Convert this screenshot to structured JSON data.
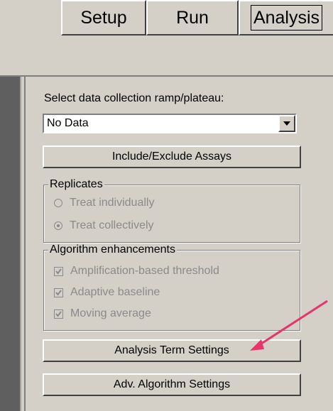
{
  "tabs": [
    {
      "label": "Setup"
    },
    {
      "label": "Run"
    },
    {
      "label": "Analysis"
    }
  ],
  "panel": {
    "ramp_label": "Select data collection ramp/plateau:",
    "ramp_value": "No Data",
    "include_exclude_button": "Include/Exclude Assays",
    "replicates": {
      "legend": "Replicates",
      "options": [
        {
          "label": "Treat individually",
          "selected": false
        },
        {
          "label": "Treat collectively",
          "selected": true
        }
      ]
    },
    "algorithm": {
      "legend": "Algorithm enhancements",
      "options": [
        {
          "label": "Amplification-based threshold",
          "checked": true
        },
        {
          "label": "Adaptive baseline",
          "checked": true
        },
        {
          "label": "Moving average",
          "checked": true
        }
      ]
    },
    "analysis_term_button": "Analysis Term Settings",
    "adv_algorithm_button": "Adv. Algorithm Settings"
  },
  "colors": {
    "annotation_arrow": "#e8336b",
    "panel_bg": "#d4d0c8"
  }
}
